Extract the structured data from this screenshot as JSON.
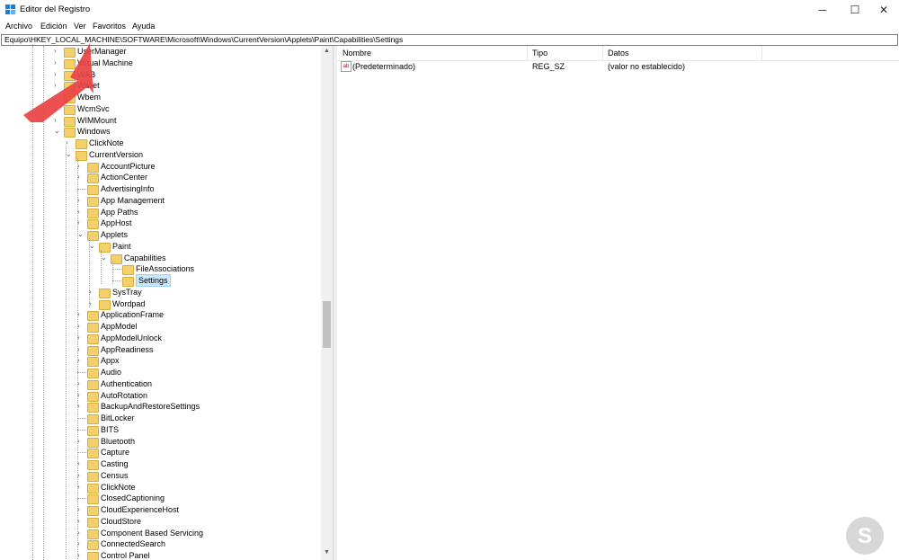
{
  "window": {
    "title": "Editor del Registro",
    "controls": {
      "minimize": "─",
      "maximize": "☐",
      "close": "✕"
    }
  },
  "menu": [
    "Archivo",
    "Edición",
    "Ver",
    "Favoritos",
    "Ayuda"
  ],
  "address": "Equipo\\HKEY_LOCAL_MACHINE\\SOFTWARE\\Microsoft\\Windows\\CurrentVersion\\Applets\\Paint\\Capabilities\\Settings",
  "tree": [
    {
      "label": "UserManager",
      "level": 0,
      "chev": "›"
    },
    {
      "label": "Virtual Machine",
      "level": 0,
      "chev": "›"
    },
    {
      "label": "WAB",
      "level": 0,
      "chev": "›"
    },
    {
      "label": "Wallet",
      "level": 0,
      "chev": "›"
    },
    {
      "label": "Wbem",
      "level": 0,
      "chev": "›"
    },
    {
      "label": "WcmSvc",
      "level": 0,
      "chev": "›"
    },
    {
      "label": "WIMMount",
      "level": 0,
      "chev": "›"
    },
    {
      "label": "Windows",
      "level": 0,
      "chev": "⌄"
    },
    {
      "label": "ClickNote",
      "level": 1,
      "chev": "›"
    },
    {
      "label": "CurrentVersion",
      "level": 1,
      "chev": "⌄"
    },
    {
      "label": "AccountPicture",
      "level": 2,
      "chev": "›"
    },
    {
      "label": "ActionCenter",
      "level": 2,
      "chev": "›"
    },
    {
      "label": "AdvertisingInfo",
      "level": 2,
      "chev": ""
    },
    {
      "label": "App Management",
      "level": 2,
      "chev": "›"
    },
    {
      "label": "App Paths",
      "level": 2,
      "chev": "›"
    },
    {
      "label": "AppHost",
      "level": 2,
      "chev": "›"
    },
    {
      "label": "Applets",
      "level": 2,
      "chev": "⌄"
    },
    {
      "label": "Paint",
      "level": 3,
      "chev": "⌄"
    },
    {
      "label": "Capabilities",
      "level": 4,
      "chev": "⌄"
    },
    {
      "label": "FileAssociations",
      "level": 5,
      "chev": ""
    },
    {
      "label": "Settings",
      "level": 5,
      "chev": "",
      "selected": true
    },
    {
      "label": "SysTray",
      "level": 3,
      "chev": "›"
    },
    {
      "label": "Wordpad",
      "level": 3,
      "chev": "›"
    },
    {
      "label": "ApplicationFrame",
      "level": 2,
      "chev": "›"
    },
    {
      "label": "AppModel",
      "level": 2,
      "chev": "›"
    },
    {
      "label": "AppModelUnlock",
      "level": 2,
      "chev": "›"
    },
    {
      "label": "AppReadiness",
      "level": 2,
      "chev": "›"
    },
    {
      "label": "Appx",
      "level": 2,
      "chev": "›"
    },
    {
      "label": "Audio",
      "level": 2,
      "chev": ""
    },
    {
      "label": "Authentication",
      "level": 2,
      "chev": "›"
    },
    {
      "label": "AutoRotation",
      "level": 2,
      "chev": "›"
    },
    {
      "label": "BackupAndRestoreSettings",
      "level": 2,
      "chev": "›"
    },
    {
      "label": "BitLocker",
      "level": 2,
      "chev": ""
    },
    {
      "label": "BITS",
      "level": 2,
      "chev": ""
    },
    {
      "label": "Bluetooth",
      "level": 2,
      "chev": "›"
    },
    {
      "label": "Capture",
      "level": 2,
      "chev": ""
    },
    {
      "label": "Casting",
      "level": 2,
      "chev": "›"
    },
    {
      "label": "Census",
      "level": 2,
      "chev": "›"
    },
    {
      "label": "ClickNote",
      "level": 2,
      "chev": "›"
    },
    {
      "label": "ClosedCaptioning",
      "level": 2,
      "chev": ""
    },
    {
      "label": "CloudExperienceHost",
      "level": 2,
      "chev": "›"
    },
    {
      "label": "CloudStore",
      "level": 2,
      "chev": "›"
    },
    {
      "label": "Component Based Servicing",
      "level": 2,
      "chev": "›"
    },
    {
      "label": "ConnectedSearch",
      "level": 2,
      "chev": "›"
    },
    {
      "label": "Control Panel",
      "level": 2,
      "chev": "›"
    }
  ],
  "list": {
    "columns": [
      "Nombre",
      "Tipo",
      "Datos"
    ],
    "rows": [
      {
        "icon": "ab",
        "name": "(Predeterminado)",
        "type": "REG_SZ",
        "data": "(valor no establecido)"
      }
    ]
  }
}
